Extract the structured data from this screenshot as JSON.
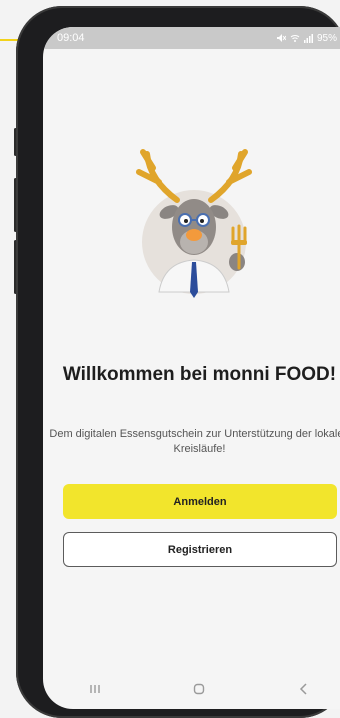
{
  "status_bar": {
    "time": "09:04",
    "battery": "95%"
  },
  "welcome": {
    "title": "Willkommen bei monni FOOD!",
    "subtitle": "Dem digitalen Essensgutschein zur Unterstützung der lokalen Kreisläufe!"
  },
  "buttons": {
    "login": "Anmelden",
    "register": "Registrieren"
  },
  "icons": {
    "status": [
      "mute-icon",
      "wifi-icon",
      "signal-icon",
      "battery-icon"
    ],
    "nav": [
      "recent-apps-icon",
      "home-icon",
      "back-icon"
    ]
  },
  "colors": {
    "accent": "#F2E52C",
    "background": "#F5F5F5"
  }
}
